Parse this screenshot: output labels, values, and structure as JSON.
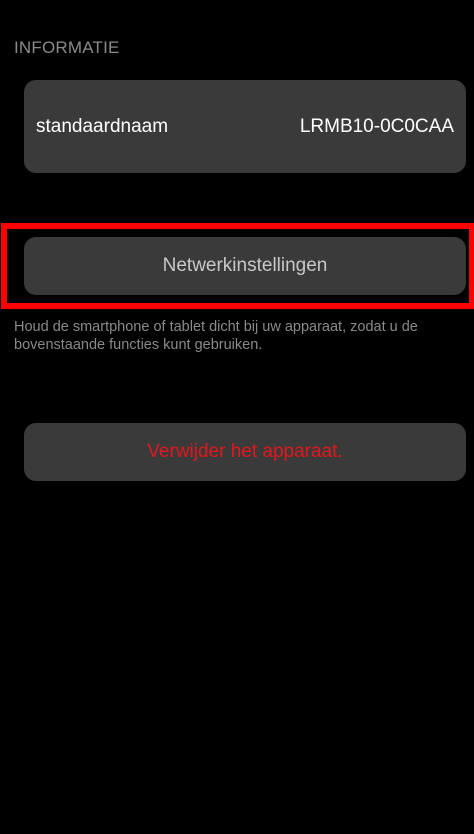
{
  "section": {
    "header": "INFORMATIE"
  },
  "info": {
    "label": "standaardnaam",
    "value": "LRMB10-0C0CAA"
  },
  "network": {
    "button_label": "Netwerkinstellingen"
  },
  "hint": {
    "text": "Houd de smartphone of tablet dicht bij uw apparaat, zodat u de bovenstaande functies kunt gebruiken."
  },
  "delete": {
    "button_label": "Verwijder het apparaat."
  },
  "colors": {
    "background": "#000000",
    "card": "#3a3a3a",
    "highlight": "#ff0000",
    "danger": "#e0181e",
    "muted_text": "#8a8a8a"
  }
}
